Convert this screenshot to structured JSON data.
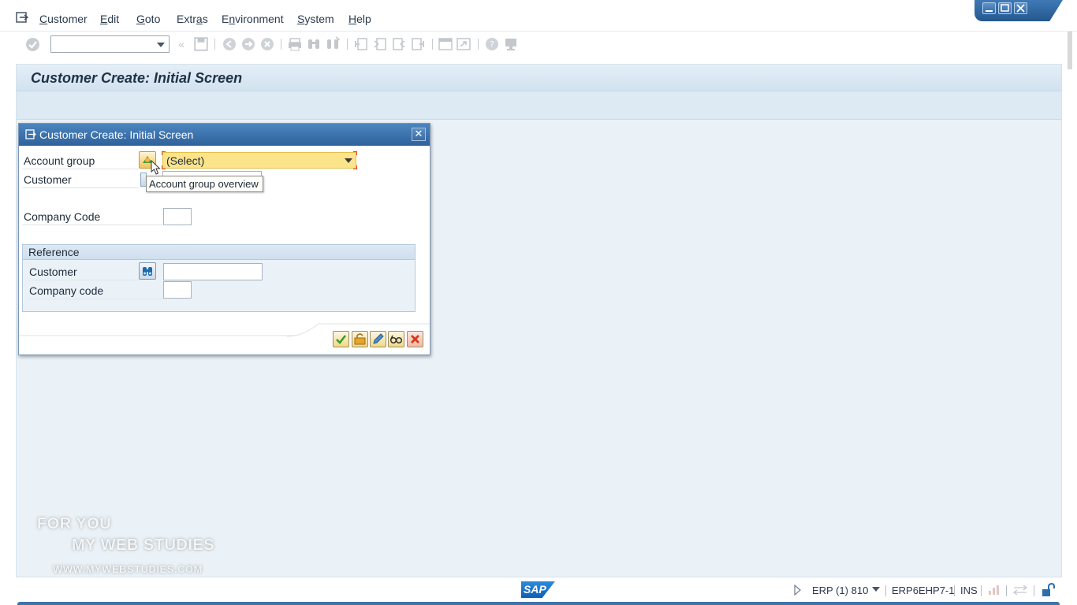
{
  "menubar": {
    "items": [
      {
        "pre": "",
        "u": "C",
        "post": "ustomer"
      },
      {
        "pre": "",
        "u": "E",
        "post": "dit"
      },
      {
        "pre": "",
        "u": "G",
        "post": "oto"
      },
      {
        "pre": "Extr",
        "u": "a",
        "post": "s"
      },
      {
        "pre": "E",
        "u": "n",
        "post": "vironment"
      },
      {
        "pre": "",
        "u": "S",
        "post": "ystem"
      },
      {
        "pre": "",
        "u": "H",
        "post": "elp"
      }
    ]
  },
  "page": {
    "title": "Customer Create: Initial Screen"
  },
  "dialog": {
    "title": "Customer Create: Initial Screen",
    "account_group_label": "Account group",
    "account_group_value": "(Select)",
    "tooltip": "Account group overview",
    "customer_label": "Customer",
    "company_code_label": "Company Code",
    "reference": {
      "title": "Reference",
      "customer_label": "Customer",
      "company_code_label": "Company code"
    }
  },
  "watermark": {
    "line1": "FOR YOU",
    "line2": "MY WEB STUDIES",
    "line3": "WWW.MYWEBSTUDIES.COM"
  },
  "statusbar": {
    "logo": "SAP",
    "system": "ERP (1) 810",
    "server": "ERP6EHP7-1",
    "mode": "INS"
  }
}
